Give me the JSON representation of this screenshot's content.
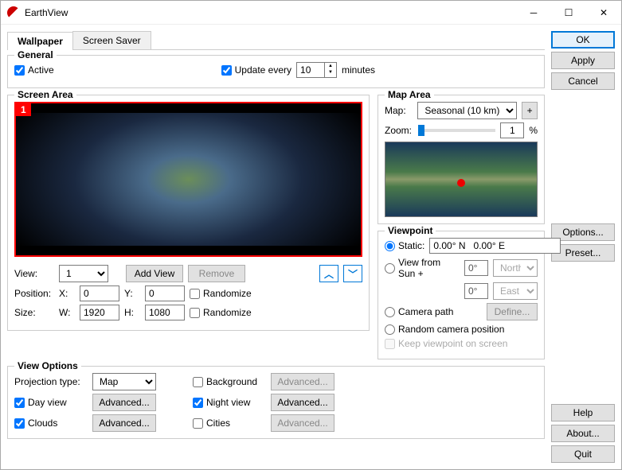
{
  "window": {
    "title": "EarthView"
  },
  "tabs": {
    "wallpaper": "Wallpaper",
    "screensaver": "Screen Saver"
  },
  "general": {
    "legend": "General",
    "active": "Active",
    "update_every": "Update every",
    "update_value": "10",
    "minutes": "minutes"
  },
  "screen_area": {
    "legend": "Screen Area",
    "indicator": "1",
    "view_label": "View:",
    "view_value": "1",
    "add_view": "Add View",
    "remove": "Remove",
    "position_label": "Position:",
    "x_label": "X:",
    "x_value": "0",
    "y_label": "Y:",
    "y_value": "0",
    "randomize": "Randomize",
    "size_label": "Size:",
    "w_label": "W:",
    "w_value": "1920",
    "h_label": "H:",
    "h_value": "1080"
  },
  "map_area": {
    "legend": "Map Area",
    "map_label": "Map:",
    "map_value": "Seasonal (10 km)",
    "plus": "+",
    "zoom_label": "Zoom:",
    "zoom_value": "1",
    "percent": "%"
  },
  "viewpoint": {
    "legend": "Viewpoint",
    "static": "Static:",
    "static_value": "0.00° N   0.00° E",
    "view_from_sun": "View from Sun  +",
    "deg0a": "0°",
    "north": "North",
    "deg0b": "0°",
    "east": "East",
    "camera_path": "Camera path",
    "define": "Define...",
    "random": "Random camera position",
    "keep": "Keep viewpoint on screen"
  },
  "view_options": {
    "legend": "View Options",
    "projection_label": "Projection type:",
    "projection_value": "Map",
    "day_view": "Day view",
    "clouds": "Clouds",
    "background": "Background",
    "night_view": "Night view",
    "cities": "Cities",
    "advanced": "Advanced..."
  },
  "buttons": {
    "ok": "OK",
    "apply": "Apply",
    "cancel": "Cancel",
    "options": "Options...",
    "preset": "Preset...",
    "help": "Help",
    "about": "About...",
    "quit": "Quit"
  }
}
